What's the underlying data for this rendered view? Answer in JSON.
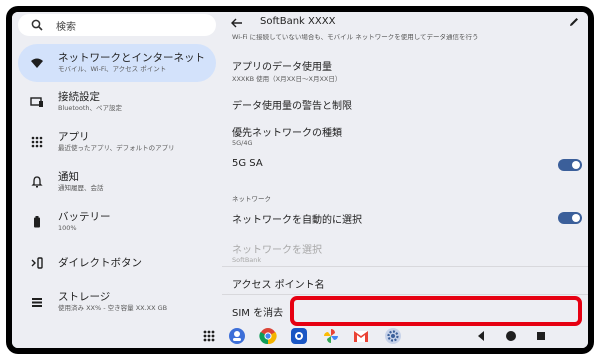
{
  "search": {
    "placeholder": "検索"
  },
  "sidebar": {
    "items": [
      {
        "title": "ネットワークとインターネット",
        "subtitle": "モバイル、Wi-Fi、アクセス ポイント",
        "icon": "wifi-icon",
        "active": true
      },
      {
        "title": "接続設定",
        "subtitle": "Bluetooth、ペア設定",
        "icon": "connected-devices-icon",
        "active": false
      },
      {
        "title": "アプリ",
        "subtitle": "最近使ったアプリ、デフォルトのアプリ",
        "icon": "apps-grid-icon",
        "active": false
      },
      {
        "title": "通知",
        "subtitle": "通知履歴、会話",
        "icon": "bell-icon",
        "active": false
      },
      {
        "title": "バッテリー",
        "subtitle": "100%",
        "icon": "battery-icon",
        "active": false
      },
      {
        "title": "ダイレクトボタン",
        "subtitle": "",
        "icon": "direct-button-icon",
        "active": false
      },
      {
        "title": "ストレージ",
        "subtitle": "使用済み XX% - 空き容量 XX.XX GB",
        "icon": "storage-icon",
        "active": false
      }
    ]
  },
  "detail": {
    "title": "SoftBank XXXX",
    "cut_text": "Wi-Fi に接続していない場合も、モバイル ネットワークを使用してデータ通信を行う",
    "data_usage": {
      "title": "アプリのデータ使用量",
      "subtitle": "XXXKB 使用（X月XX日～X月XX日）"
    },
    "data_warning": {
      "title": "データ使用量の警告と制限"
    },
    "preferred_network": {
      "title": "優先ネットワークの種類",
      "subtitle": "5G/4G"
    },
    "sa_5g": {
      "title": "5G SA",
      "enabled": true
    },
    "network_section": "ネットワーク",
    "auto_select": {
      "title": "ネットワークを自動的に選択",
      "enabled": true
    },
    "select_network": {
      "title": "ネットワークを選択",
      "subtitle": "SoftBank",
      "disabled": true
    },
    "apn": {
      "title": "アクセス ポイント名"
    },
    "erase_sim": {
      "title": "SIM を消去"
    }
  },
  "colors": {
    "highlight": "#e60012",
    "active_nav": "#d3e2fb",
    "toggle_on": "#3b5f9a",
    "background": "#edeef3"
  },
  "taskbar": [
    "apps-grid-icon",
    "bubble-app-icon",
    "chrome-icon",
    "camera-icon",
    "photos-icon",
    "gmail-icon",
    "settings-icon",
    "back-icon",
    "home-icon",
    "recents-icon"
  ]
}
